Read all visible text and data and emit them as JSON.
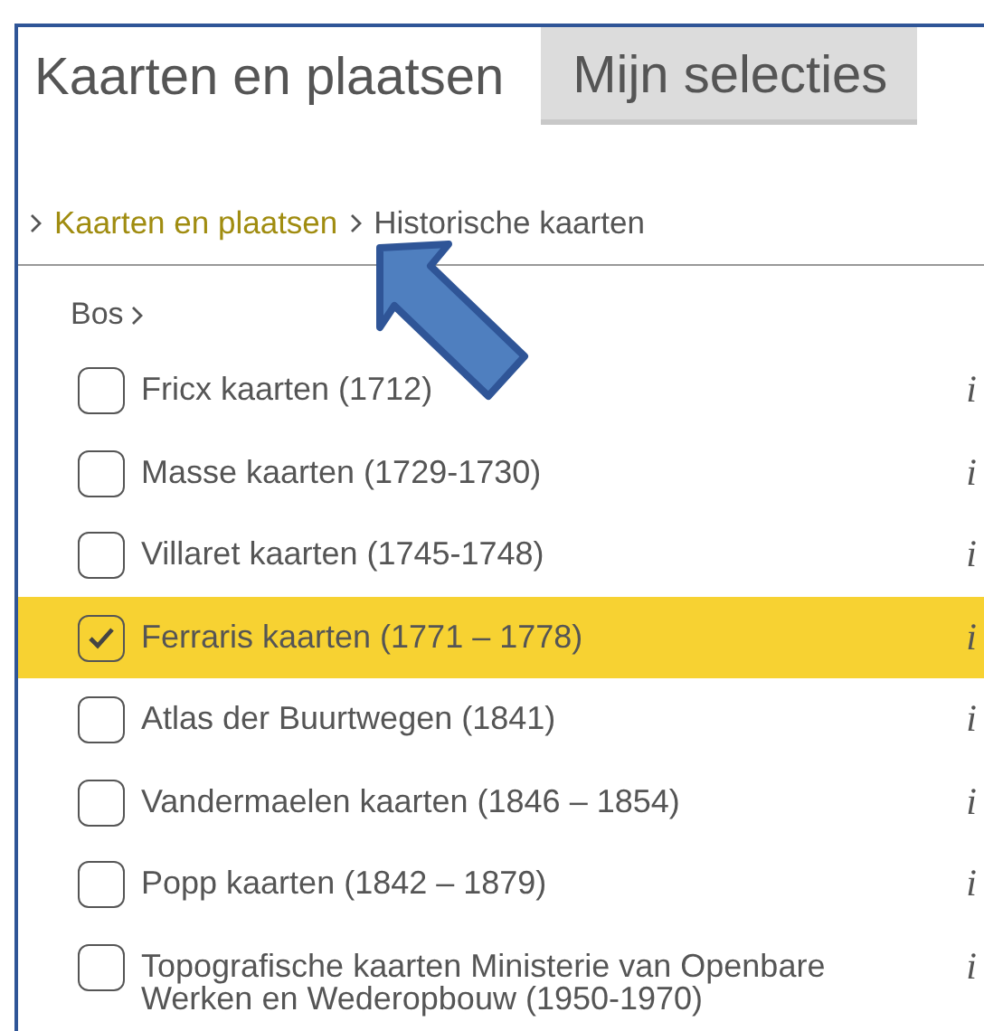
{
  "tabs": [
    {
      "label": "Kaarten en plaatsen",
      "selected": true
    },
    {
      "label": "Mijn selecties",
      "selected": false
    }
  ],
  "breadcrumb": [
    {
      "label": "Kaarten en plaatsen",
      "kind": "link"
    },
    {
      "label": "Historische kaarten",
      "kind": "current"
    }
  ],
  "category": "Bos",
  "layers": [
    {
      "label": "Fricx kaarten (1712)",
      "checked": false,
      "info": "i"
    },
    {
      "label": "Masse kaarten (1729-1730)",
      "checked": false,
      "info": "i"
    },
    {
      "label": "Villaret kaarten (1745-1748)",
      "checked": false,
      "info": "i"
    },
    {
      "label": "Ferraris kaarten (1771 – 1778)",
      "checked": true,
      "info": "i"
    },
    {
      "label": "Atlas der Buurtwegen (1841)",
      "checked": false,
      "info": "i"
    },
    {
      "label": "Vandermaelen kaarten (1846 – 1854)",
      "checked": false,
      "info": "i"
    },
    {
      "label": "Popp kaarten (1842 – 1879)",
      "checked": false,
      "info": "i"
    },
    {
      "label": "Topografische kaarten Ministerie van Openbare Werken en Wederopbouw (1950-1970)",
      "checked": false,
      "info": "i"
    }
  ]
}
